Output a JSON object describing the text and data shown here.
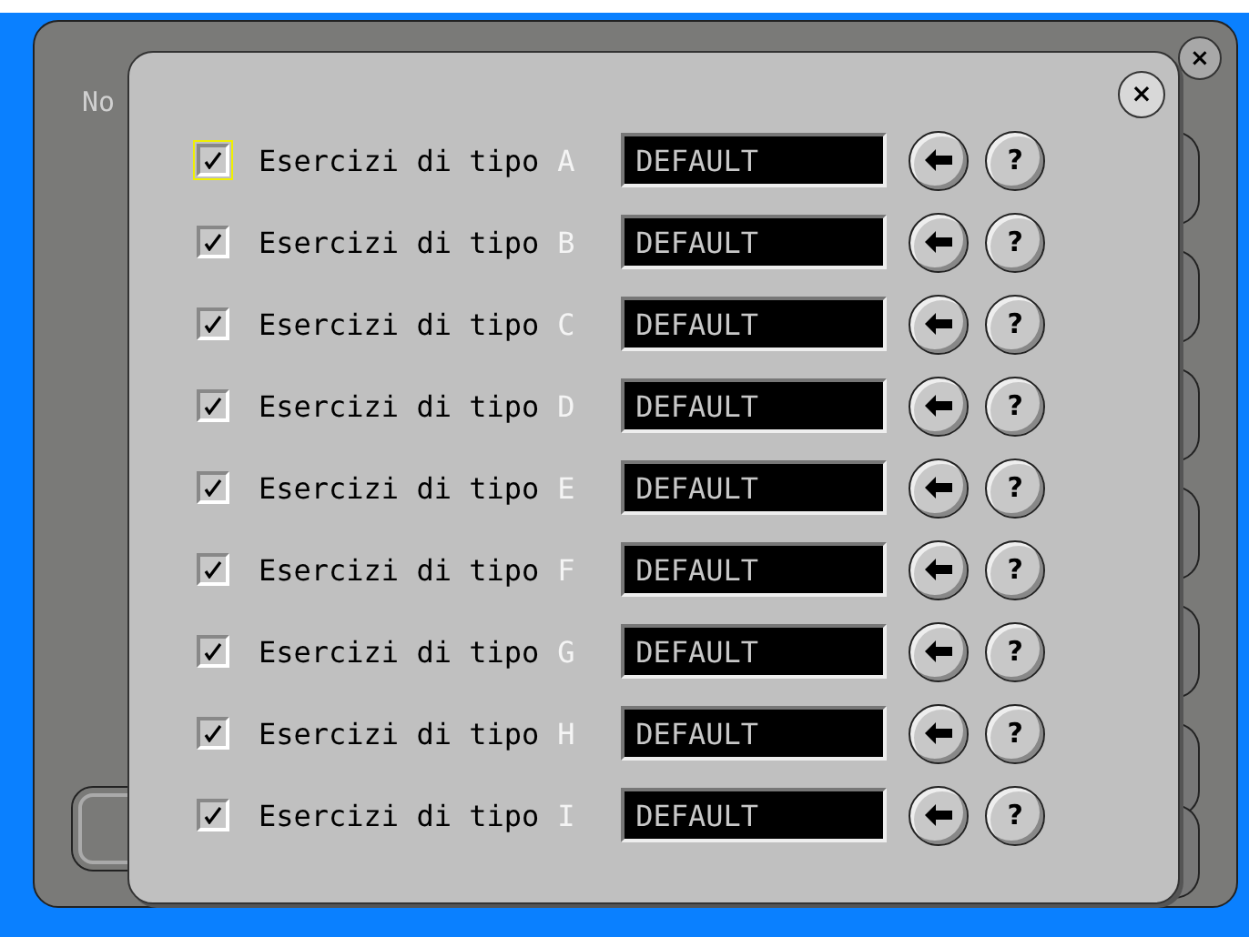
{
  "background_window": {
    "label": "No"
  },
  "dialog": {
    "close": "×",
    "rows": [
      {
        "label": "Esercizi di tipo",
        "letter": "A",
        "checked": true,
        "focused": true,
        "value": "DEFAULT"
      },
      {
        "label": "Esercizi di tipo",
        "letter": "B",
        "checked": true,
        "focused": false,
        "value": "DEFAULT"
      },
      {
        "label": "Esercizi di tipo",
        "letter": "C",
        "checked": true,
        "focused": false,
        "value": "DEFAULT"
      },
      {
        "label": "Esercizi di tipo",
        "letter": "D",
        "checked": true,
        "focused": false,
        "value": "DEFAULT"
      },
      {
        "label": "Esercizi di tipo",
        "letter": "E",
        "checked": true,
        "focused": false,
        "value": "DEFAULT"
      },
      {
        "label": "Esercizi di tipo",
        "letter": "F",
        "checked": true,
        "focused": false,
        "value": "DEFAULT"
      },
      {
        "label": "Esercizi di tipo",
        "letter": "G",
        "checked": true,
        "focused": false,
        "value": "DEFAULT"
      },
      {
        "label": "Esercizi di tipo",
        "letter": "H",
        "checked": true,
        "focused": false,
        "value": "DEFAULT"
      },
      {
        "label": "Esercizi di tipo",
        "letter": "I",
        "checked": true,
        "focused": false,
        "value": "DEFAULT"
      }
    ],
    "help": "?"
  },
  "background_close": "×"
}
